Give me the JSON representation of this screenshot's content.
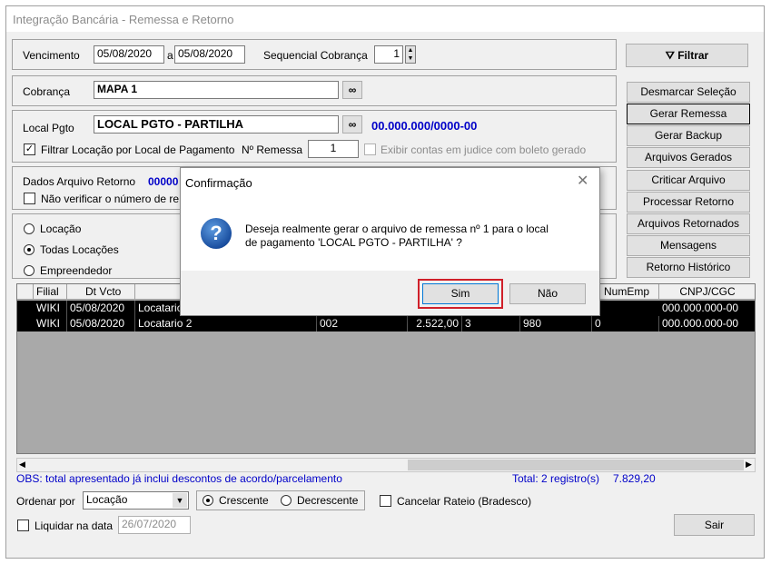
{
  "window": {
    "title": "Integração Bancária - Remessa e Retorno"
  },
  "filters": {
    "vencimento_label": "Vencimento",
    "date_from": "05/08/2020",
    "a_label": "a",
    "date_to": "05/08/2020",
    "sequencial_label": "Sequencial Cobrança",
    "sequencial_value": "1",
    "filtrar_label": "Filtrar",
    "cobranca_label": "Cobrança",
    "cobranca_value": "MAPA 1",
    "local_pgto_label": "Local Pgto",
    "local_pgto_value": "LOCAL PGTO - PARTILHA",
    "local_pgto_account": "00.000.000/0000-00",
    "filtrar_locacao_label": "Filtrar Locação por Local de Pagamento",
    "nremessa_label": "Nº Remessa",
    "nremessa_value": "1",
    "exibir_contas_label": "Exibir contas em judice com boleto gerado",
    "dados_arquivo_label": "Dados Arquivo Retorno",
    "dados_arquivo_value": "00000",
    "nao_verificar_label": "Não verificar o número de re",
    "radio_locacao": "Locação",
    "radio_todas": "Todas Locações",
    "radio_empreendedor": "Empreendedor"
  },
  "side_buttons": [
    "Desmarcar Seleção",
    "Gerar Remessa",
    "Gerar Backup",
    "Arquivos Gerados",
    "Criticar Arquivo",
    "Processar Retorno",
    "Arquivos Retornados",
    "Mensagens",
    "Retorno Histórico"
  ],
  "grid": {
    "columns": [
      "Filial",
      "Dt Vcto",
      "NumEmp",
      "CNPJ/CGC"
    ],
    "rows": [
      {
        "filial": "WIKI",
        "dt_vcto": "05/08/2020",
        "locatario": "Locatario",
        "c4": "",
        "valor": "",
        "c6": "",
        "c7": "",
        "c8": "",
        "cnpj": "000.000.000-00"
      },
      {
        "filial": "WIKI",
        "dt_vcto": "05/08/2020",
        "locatario": "Locatario 2",
        "c4": "002",
        "valor": "2.522,00",
        "c6": "3",
        "c7": "980",
        "c8": "0",
        "cnpj": "000.000.000-00"
      }
    ]
  },
  "footer": {
    "obs": "OBS: total apresentado já inclui descontos de acordo/parcelamento",
    "total_label": "Total: 2 registro(s)",
    "total_value": "7.829,20",
    "ordenar_label": "Ordenar por",
    "ordenar_value": "Locação",
    "crescente": "Crescente",
    "decrescente": "Decrescente",
    "cancelar_rateio": "Cancelar Rateio (Bradesco)",
    "liquidar_label": "Liquidar na data",
    "liquidar_value": "26/07/2020",
    "sair_label": "Sair"
  },
  "dialog": {
    "title": "Confirmação",
    "message_line1": "Deseja realmente gerar o arquivo de remessa nº 1 para o local",
    "message_line2": "de pagamento 'LOCAL PGTO - PARTILHA' ?",
    "yes_label": "Sim",
    "no_label": "Não"
  }
}
